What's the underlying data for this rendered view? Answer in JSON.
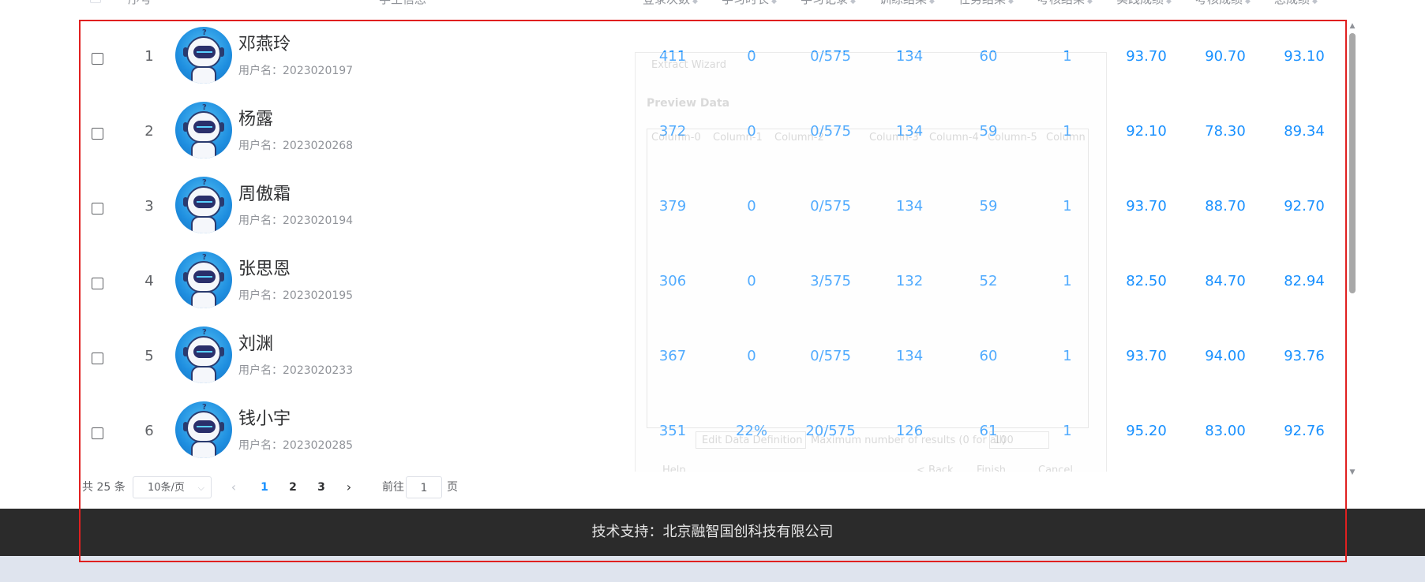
{
  "table": {
    "headers": [
      "序号",
      "学生信息",
      "登录次数",
      "学习时长",
      "学习记录",
      "训练结果",
      "任务结果",
      "考核结果",
      "实践成绩",
      "考核成绩",
      "总成绩"
    ],
    "rows": [
      {
        "index": "1",
        "name": "邓燕玲",
        "username": "用户名：2023020197",
        "logins": "411",
        "study_time": "0",
        "study_record": "0/575",
        "training": "134",
        "task": "60",
        "assessment": "1",
        "practice_score": "93.70",
        "exam_score": "90.70",
        "total_score": "93.10"
      },
      {
        "index": "2",
        "name": "杨露",
        "username": "用户名：2023020268",
        "logins": "372",
        "study_time": "0",
        "study_record": "0/575",
        "training": "134",
        "task": "59",
        "assessment": "1",
        "practice_score": "92.10",
        "exam_score": "78.30",
        "total_score": "89.34"
      },
      {
        "index": "3",
        "name": "周傲霜",
        "username": "用户名：2023020194",
        "logins": "379",
        "study_time": "0",
        "study_record": "0/575",
        "training": "134",
        "task": "59",
        "assessment": "1",
        "practice_score": "93.70",
        "exam_score": "88.70",
        "total_score": "92.70"
      },
      {
        "index": "4",
        "name": "张思恩",
        "username": "用户名：2023020195",
        "logins": "306",
        "study_time": "0",
        "study_record": "3/575",
        "training": "132",
        "task": "52",
        "assessment": "1",
        "practice_score": "82.50",
        "exam_score": "84.70",
        "total_score": "82.94"
      },
      {
        "index": "5",
        "name": "刘渊",
        "username": "用户名：2023020233",
        "logins": "367",
        "study_time": "0",
        "study_record": "0/575",
        "training": "134",
        "task": "60",
        "assessment": "1",
        "practice_score": "93.70",
        "exam_score": "94.00",
        "total_score": "93.76"
      },
      {
        "index": "6",
        "name": "钱小宇",
        "username": "用户名：2023020285",
        "logins": "351",
        "study_time": "22%",
        "study_record": "20/575",
        "training": "126",
        "task": "61",
        "assessment": "1",
        "practice_score": "95.20",
        "exam_score": "83.00",
        "total_score": "92.76"
      }
    ]
  },
  "ghost_dialog": {
    "title": "Extract Wizard",
    "heading": "Preview Data",
    "columns": [
      "Column-0",
      "Column-1",
      "Column-2",
      "Column-3",
      "Column-4",
      "Column-5",
      "Column"
    ],
    "edit_button": "Edit Data Definition",
    "max_label": "Maximum number of results (0 for all)",
    "max_value": "100",
    "help": "Help",
    "back": "< Back",
    "finish": "Finish",
    "cancel": "Cancel"
  },
  "pagination": {
    "total": "共 25 条",
    "page_size": "10条/页",
    "prev_icon": "‹",
    "next_icon": "›",
    "pages": [
      "1",
      "2",
      "3"
    ],
    "current_page": "1",
    "goto_label": "前往",
    "goto_value": "1",
    "goto_suffix": "页"
  },
  "footer": {
    "text": "技术支持：北京融智国创科技有限公司"
  },
  "colors": {
    "link_blue": "#1890ff",
    "footer_bg": "#2b2b2b",
    "highlight": "#e02020"
  }
}
